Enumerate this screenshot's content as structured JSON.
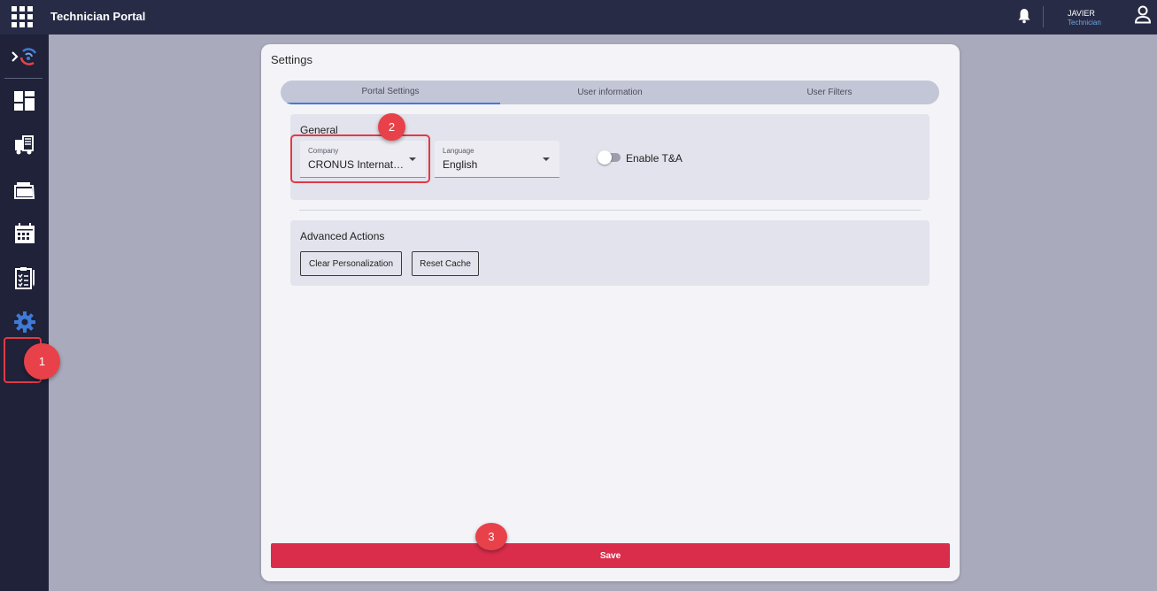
{
  "app": {
    "title": "Technician Portal"
  },
  "user": {
    "name": "JAVIER",
    "role": "Technician"
  },
  "sidebar": {
    "items": [
      {
        "name": "expand",
        "icon": "chevron-right-logo-icon"
      },
      {
        "name": "dashboard",
        "icon": "dashboard-icon"
      },
      {
        "name": "delivery",
        "icon": "truck-icon"
      },
      {
        "name": "documents",
        "icon": "folder-icon"
      },
      {
        "name": "calendar",
        "icon": "calendar-icon"
      },
      {
        "name": "tasks",
        "icon": "clipboard-icon"
      },
      {
        "name": "settings",
        "icon": "gear-icon",
        "active": true
      }
    ]
  },
  "callouts": {
    "one": "1",
    "two": "2",
    "three": "3"
  },
  "settings": {
    "title": "Settings",
    "tabs": [
      {
        "label": "Portal Settings",
        "active": true
      },
      {
        "label": "User information",
        "active": false
      },
      {
        "label": "User Filters",
        "active": false
      }
    ],
    "general": {
      "title": "General",
      "company": {
        "label": "Company",
        "value": "CRONUS International..."
      },
      "language": {
        "label": "Language",
        "value": "English"
      },
      "toggle": {
        "label": "Enable T&A",
        "enabled": false
      }
    },
    "advanced": {
      "title": "Advanced Actions",
      "clear_label": "Clear Personalization",
      "reset_label": "Reset Cache"
    },
    "save_label": "Save"
  },
  "colors": {
    "topbar": "#272b46",
    "sidebar": "#1f2238",
    "accent": "#3f7ad6",
    "save": "#d92d4b",
    "callout": "#e8414a"
  }
}
